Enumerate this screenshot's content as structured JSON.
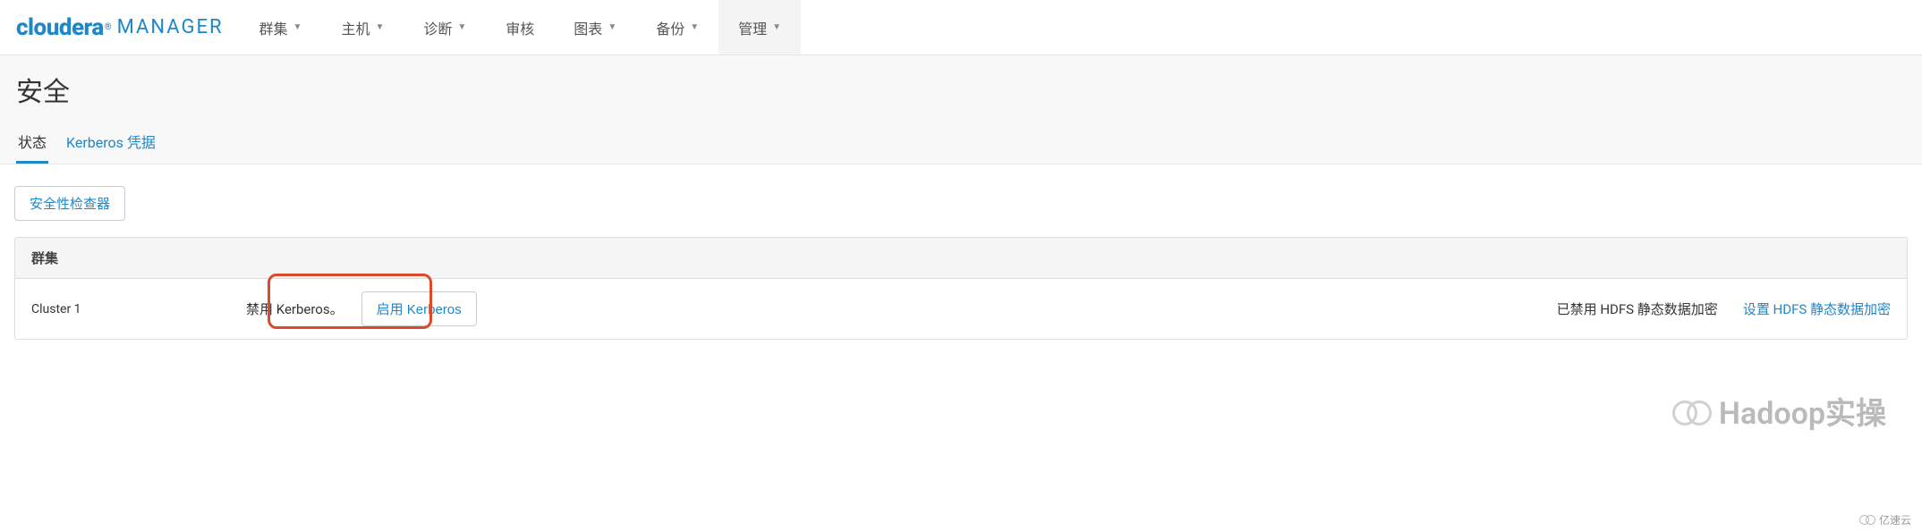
{
  "brand": {
    "name": "cloudera",
    "suffix": "MANAGER"
  },
  "nav": [
    {
      "label": "群集",
      "caret": true
    },
    {
      "label": "主机",
      "caret": true
    },
    {
      "label": "诊断",
      "caret": true
    },
    {
      "label": "审核",
      "caret": false
    },
    {
      "label": "图表",
      "caret": true
    },
    {
      "label": "备份",
      "caret": true
    },
    {
      "label": "管理",
      "caret": true,
      "active": true
    }
  ],
  "page": {
    "title": "安全"
  },
  "tabs": [
    {
      "label": "状态",
      "active": true
    },
    {
      "label": "Kerberos 凭据",
      "active": false
    }
  ],
  "buttons": {
    "security_checker": "安全性检查器",
    "enable_kerberos": "启用 Kerberos"
  },
  "table": {
    "header": "群集",
    "rows": [
      {
        "cluster": "Cluster 1",
        "kerberos_label": "禁用 Kerberos。",
        "hdfs_status": "已禁用 HDFS 静态数据加密",
        "hdfs_action": "设置 HDFS 静态数据加密"
      }
    ]
  },
  "watermark": {
    "text": "Hadoop实操"
  },
  "footer": {
    "brand": "亿速云"
  }
}
